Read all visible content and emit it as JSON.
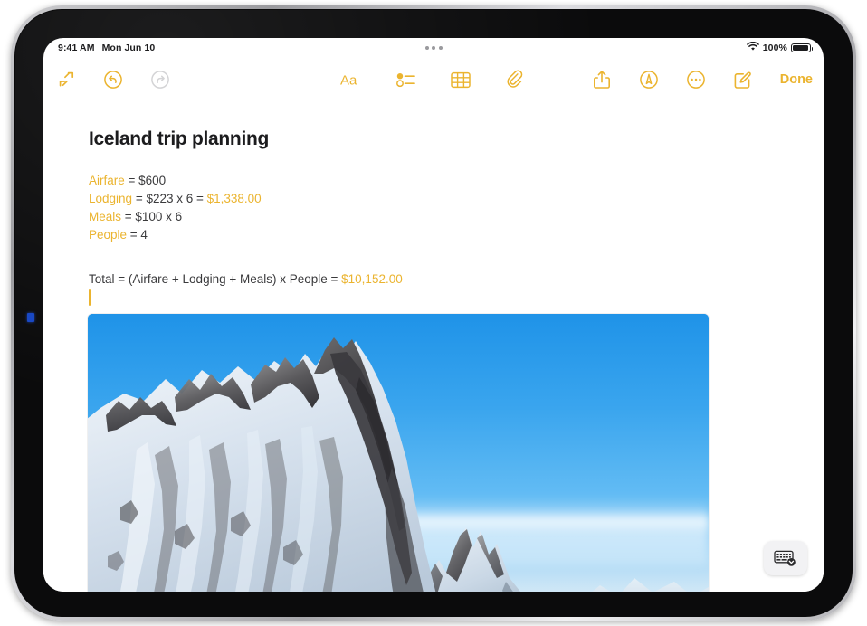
{
  "device": {
    "type": "tablet",
    "frame_color": "#b5b5b9",
    "bezel_color": "#0b0b0c"
  },
  "status_bar": {
    "time": "9:41 AM",
    "date": "Mon Jun 10",
    "multitask_handle": "three-dots-handle",
    "wifi_icon": "wifi-icon",
    "battery_percent": "100%",
    "battery_icon": "battery-full-icon"
  },
  "toolbar": {
    "left": [
      {
        "name": "collapse-icon",
        "label": "Collapse",
        "state": "enabled"
      },
      {
        "name": "undo-icon",
        "label": "Undo",
        "state": "enabled"
      },
      {
        "name": "redo-icon",
        "label": "Redo",
        "state": "disabled"
      }
    ],
    "center": [
      {
        "name": "format-text-icon",
        "label": "Aa"
      },
      {
        "name": "checklist-icon",
        "label": "Checklist"
      },
      {
        "name": "table-icon",
        "label": "Table"
      },
      {
        "name": "attachment-icon",
        "label": "Attach"
      }
    ],
    "right": [
      {
        "name": "share-icon",
        "label": "Share"
      },
      {
        "name": "markup-icon",
        "label": "Markup"
      },
      {
        "name": "more-icon",
        "label": "More"
      },
      {
        "name": "compose-icon",
        "label": "New Note"
      }
    ],
    "done_label": "Done"
  },
  "note": {
    "title": "Iceland trip planning",
    "lines": [
      {
        "var": "Airfare",
        "rest": " = $600",
        "result": ""
      },
      {
        "var": "Lodging",
        "rest": " = $223 x 6  = ",
        "result": "$1,338.00"
      },
      {
        "var": "Meals",
        "rest": " = $100 x 6",
        "result": ""
      },
      {
        "var": "People",
        "rest": " = 4",
        "result": ""
      }
    ],
    "total": {
      "expression": "Total = (Airfare + Lodging + Meals)  x People  = ",
      "result": "$10,152.00"
    },
    "cursor_visible": true,
    "photo": {
      "name": "iceland-mountain-photo",
      "description": "Snow-covered jagged mountain peaks under a clear blue sky",
      "alt": "Vestrahorn mountain in winter"
    }
  },
  "keyboard_dismiss": {
    "name": "hide-keyboard-button",
    "label": "Hide Keyboard"
  },
  "home_indicator": {
    "visible": true
  },
  "colors": {
    "accent": "#EBB42F",
    "text_primary": "#1c1c1e",
    "text_body": "#3a3a3c",
    "disabled": "#d4d4d6",
    "screen_bg": "#ffffff",
    "sky_blue": "#2f9bea"
  }
}
